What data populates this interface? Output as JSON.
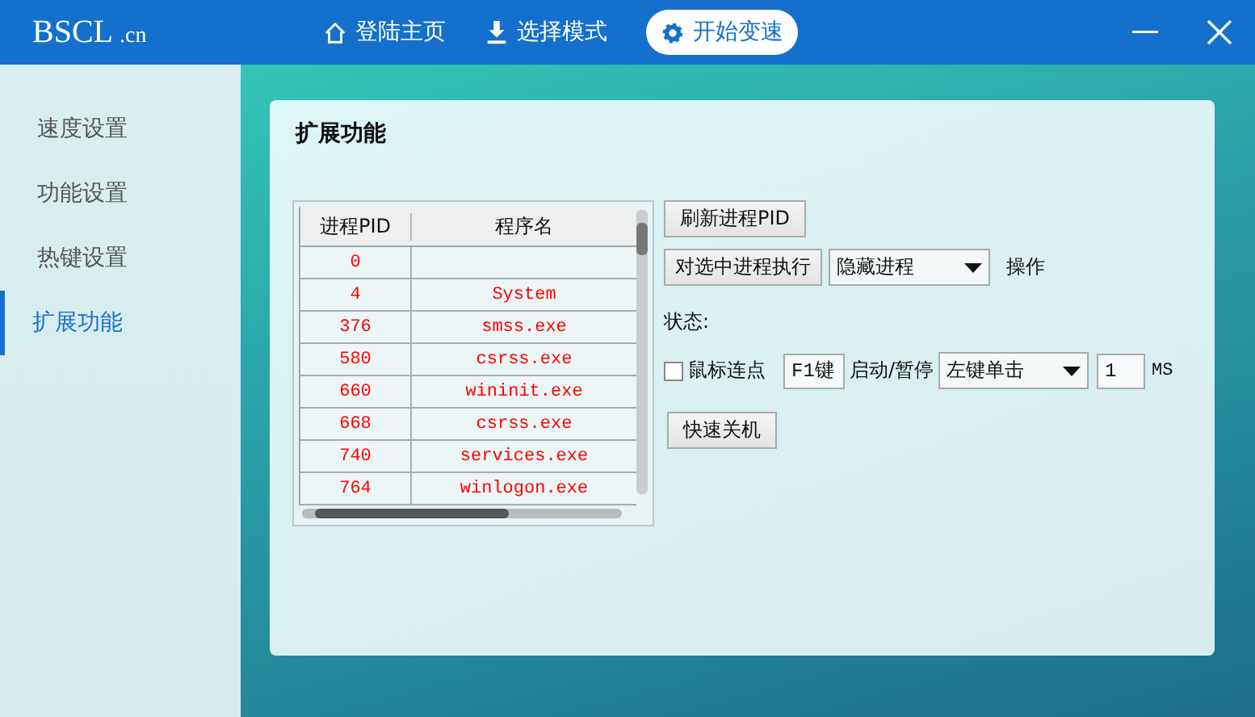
{
  "logo": {
    "main": "BSCL",
    "suffix": ".cn"
  },
  "nav": [
    {
      "label": "登陆主页",
      "selected": false
    },
    {
      "label": "选择模式",
      "selected": false
    },
    {
      "label": "开始变速",
      "selected": true
    }
  ],
  "sidebar": {
    "items": [
      {
        "label": "速度设置",
        "selected": false
      },
      {
        "label": "功能设置",
        "selected": false
      },
      {
        "label": "热键设置",
        "selected": false
      },
      {
        "label": "扩展功能",
        "selected": true
      }
    ]
  },
  "panel": {
    "title": "扩展功能",
    "table": {
      "columns": [
        "进程PID",
        "程序名"
      ],
      "rows": [
        {
          "pid": "0",
          "name": ""
        },
        {
          "pid": "4",
          "name": "System"
        },
        {
          "pid": "376",
          "name": "smss.exe"
        },
        {
          "pid": "580",
          "name": "csrss.exe"
        },
        {
          "pid": "660",
          "name": "wininit.exe"
        },
        {
          "pid": "668",
          "name": "csrss.exe"
        },
        {
          "pid": "740",
          "name": "services.exe"
        },
        {
          "pid": "764",
          "name": "winlogon.exe"
        }
      ]
    },
    "refresh_button": "刷新进程PID",
    "execute_button": "对选中进程执行",
    "action_dropdown": {
      "value": "隐藏进程"
    },
    "action_label": "操作",
    "status_label": "状态:",
    "autoclick": {
      "label": "鼠标连点",
      "checked": false,
      "hotkey": "F1键",
      "hotkey_label": "启动/暂停",
      "mode": "左键单击",
      "interval": "1",
      "unit": "MS"
    },
    "shutdown_button": "快速关机"
  }
}
